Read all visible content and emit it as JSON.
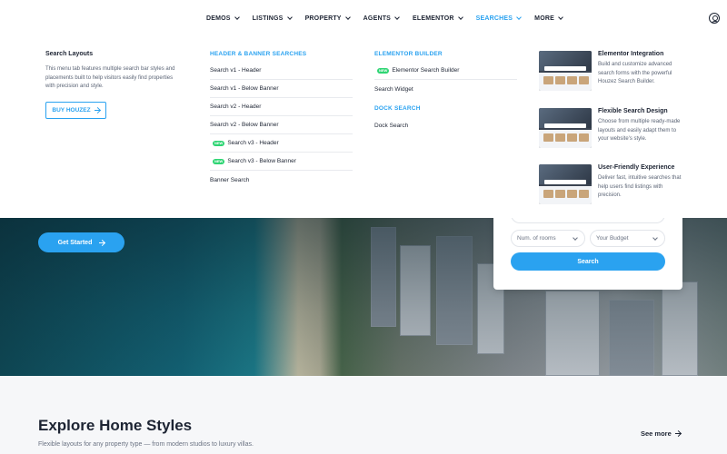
{
  "nav": {
    "items": [
      {
        "label": "DEMOS",
        "active": false
      },
      {
        "label": "LISTINGS",
        "active": false
      },
      {
        "label": "PROPERTY",
        "active": false
      },
      {
        "label": "AGENTS",
        "active": false
      },
      {
        "label": "ELEMENTOR",
        "active": false
      },
      {
        "label": "SEARCHES",
        "active": true
      },
      {
        "label": "MORE",
        "active": false
      }
    ]
  },
  "mega": {
    "intro": {
      "title": "Search Layouts",
      "description": "This menu tab features multiple search bar styles and placements built to help visitors easily find properties with precision and style.",
      "button_label": "BUY HOUZEZ"
    },
    "header_banner": {
      "heading": "HEADER & BANNER SEARCHES",
      "links": [
        {
          "label": "Search v1 - Header",
          "badge": ""
        },
        {
          "label": "Search v1 - Below Banner",
          "badge": ""
        },
        {
          "label": "Search v2 - Header",
          "badge": ""
        },
        {
          "label": "Search v2 - Below Banner",
          "badge": ""
        },
        {
          "label": "Search v3 - Header",
          "badge": "NEW"
        },
        {
          "label": "Search v3 - Below Banner",
          "badge": "NEW"
        },
        {
          "label": "Banner Search",
          "badge": ""
        }
      ]
    },
    "elementor": {
      "heading": "ELEMENTOR BUILDER",
      "links": [
        {
          "label": "Elementor Search Builder",
          "badge": "NEW"
        },
        {
          "label": "Search Widget",
          "badge": ""
        }
      ]
    },
    "dock": {
      "heading": "DOCK SEARCH",
      "links": [
        {
          "label": "Dock Search",
          "badge": ""
        }
      ]
    },
    "features": [
      {
        "title": "Elementor Integration",
        "description": "Build and customize advanced search forms with the powerful Houzez Search Builder."
      },
      {
        "title": "Flexible Search Design",
        "description": "Choose from multiple ready-made layouts and easily adapt them to your website's style."
      },
      {
        "title": "User-Friendly Experience",
        "description": "Deliver fast, intuitive searches that help users find listings with precision."
      }
    ]
  },
  "hero": {
    "cta_label": "Get Started"
  },
  "search_card": {
    "rooms_placeholder": "Num. of rooms",
    "budget_placeholder": "Your Budget",
    "search_label": "Search"
  },
  "explore": {
    "title": "Explore Home Styles",
    "subtitle": "Flexible layouts for any property type — from modern studios to luxury villas.",
    "see_more_label": "See more"
  },
  "colors": {
    "accent": "#2aa2f0",
    "new_badge": "#2ed573",
    "text": "#1d2433"
  }
}
